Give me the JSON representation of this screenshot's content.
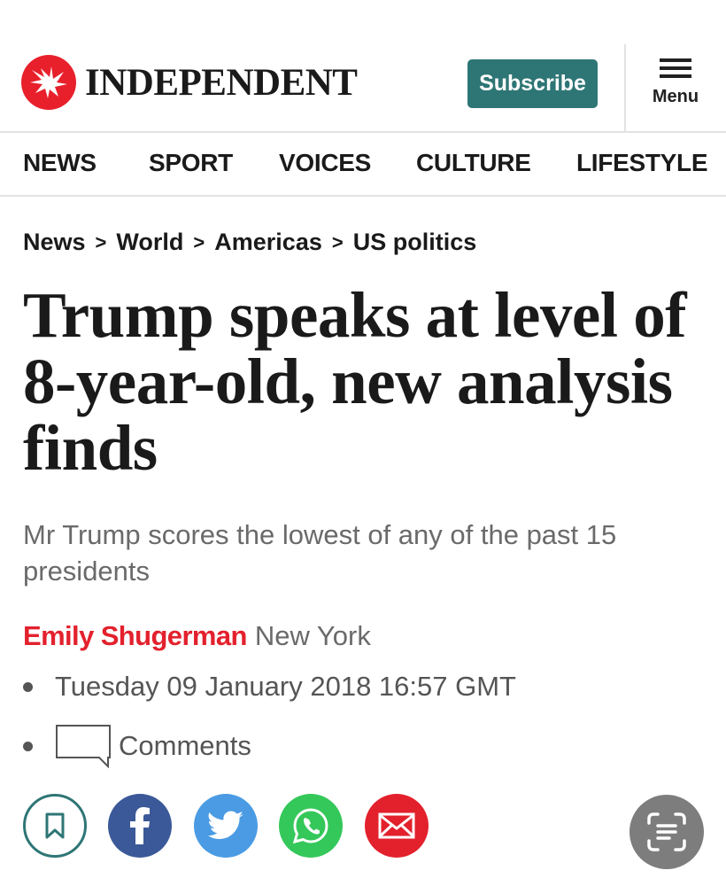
{
  "header": {
    "logo_text": "INDEPENDENT",
    "subscribe_label": "Subscribe",
    "menu_label": "Menu"
  },
  "nav": {
    "items": [
      "NEWS",
      "SPORT",
      "VOICES",
      "CULTURE",
      "LIFESTYLE"
    ]
  },
  "breadcrumb": {
    "items": [
      "News",
      "World",
      "Americas",
      "US politics"
    ],
    "separator": ">"
  },
  "article": {
    "headline": "Trump speaks at level of 8-year-old, new analysis finds",
    "standfirst": "Mr Trump scores the lowest of any of the past 15 presidents",
    "author": "Emily Shugerman",
    "location": "New York",
    "date": "Tuesday 09 January 2018 16:57 GMT",
    "comments_label": "Comments"
  },
  "share": {
    "icons": [
      "bookmark-icon",
      "facebook-icon",
      "twitter-icon",
      "whatsapp-icon",
      "email-icon"
    ]
  },
  "colors": {
    "brand_red": "#e8202c",
    "subscribe_teal": "#2e7675",
    "facebook": "#3b5998",
    "twitter": "#4a9be3",
    "whatsapp": "#34c759",
    "email": "#e3212d",
    "author_red": "#e3212d"
  }
}
